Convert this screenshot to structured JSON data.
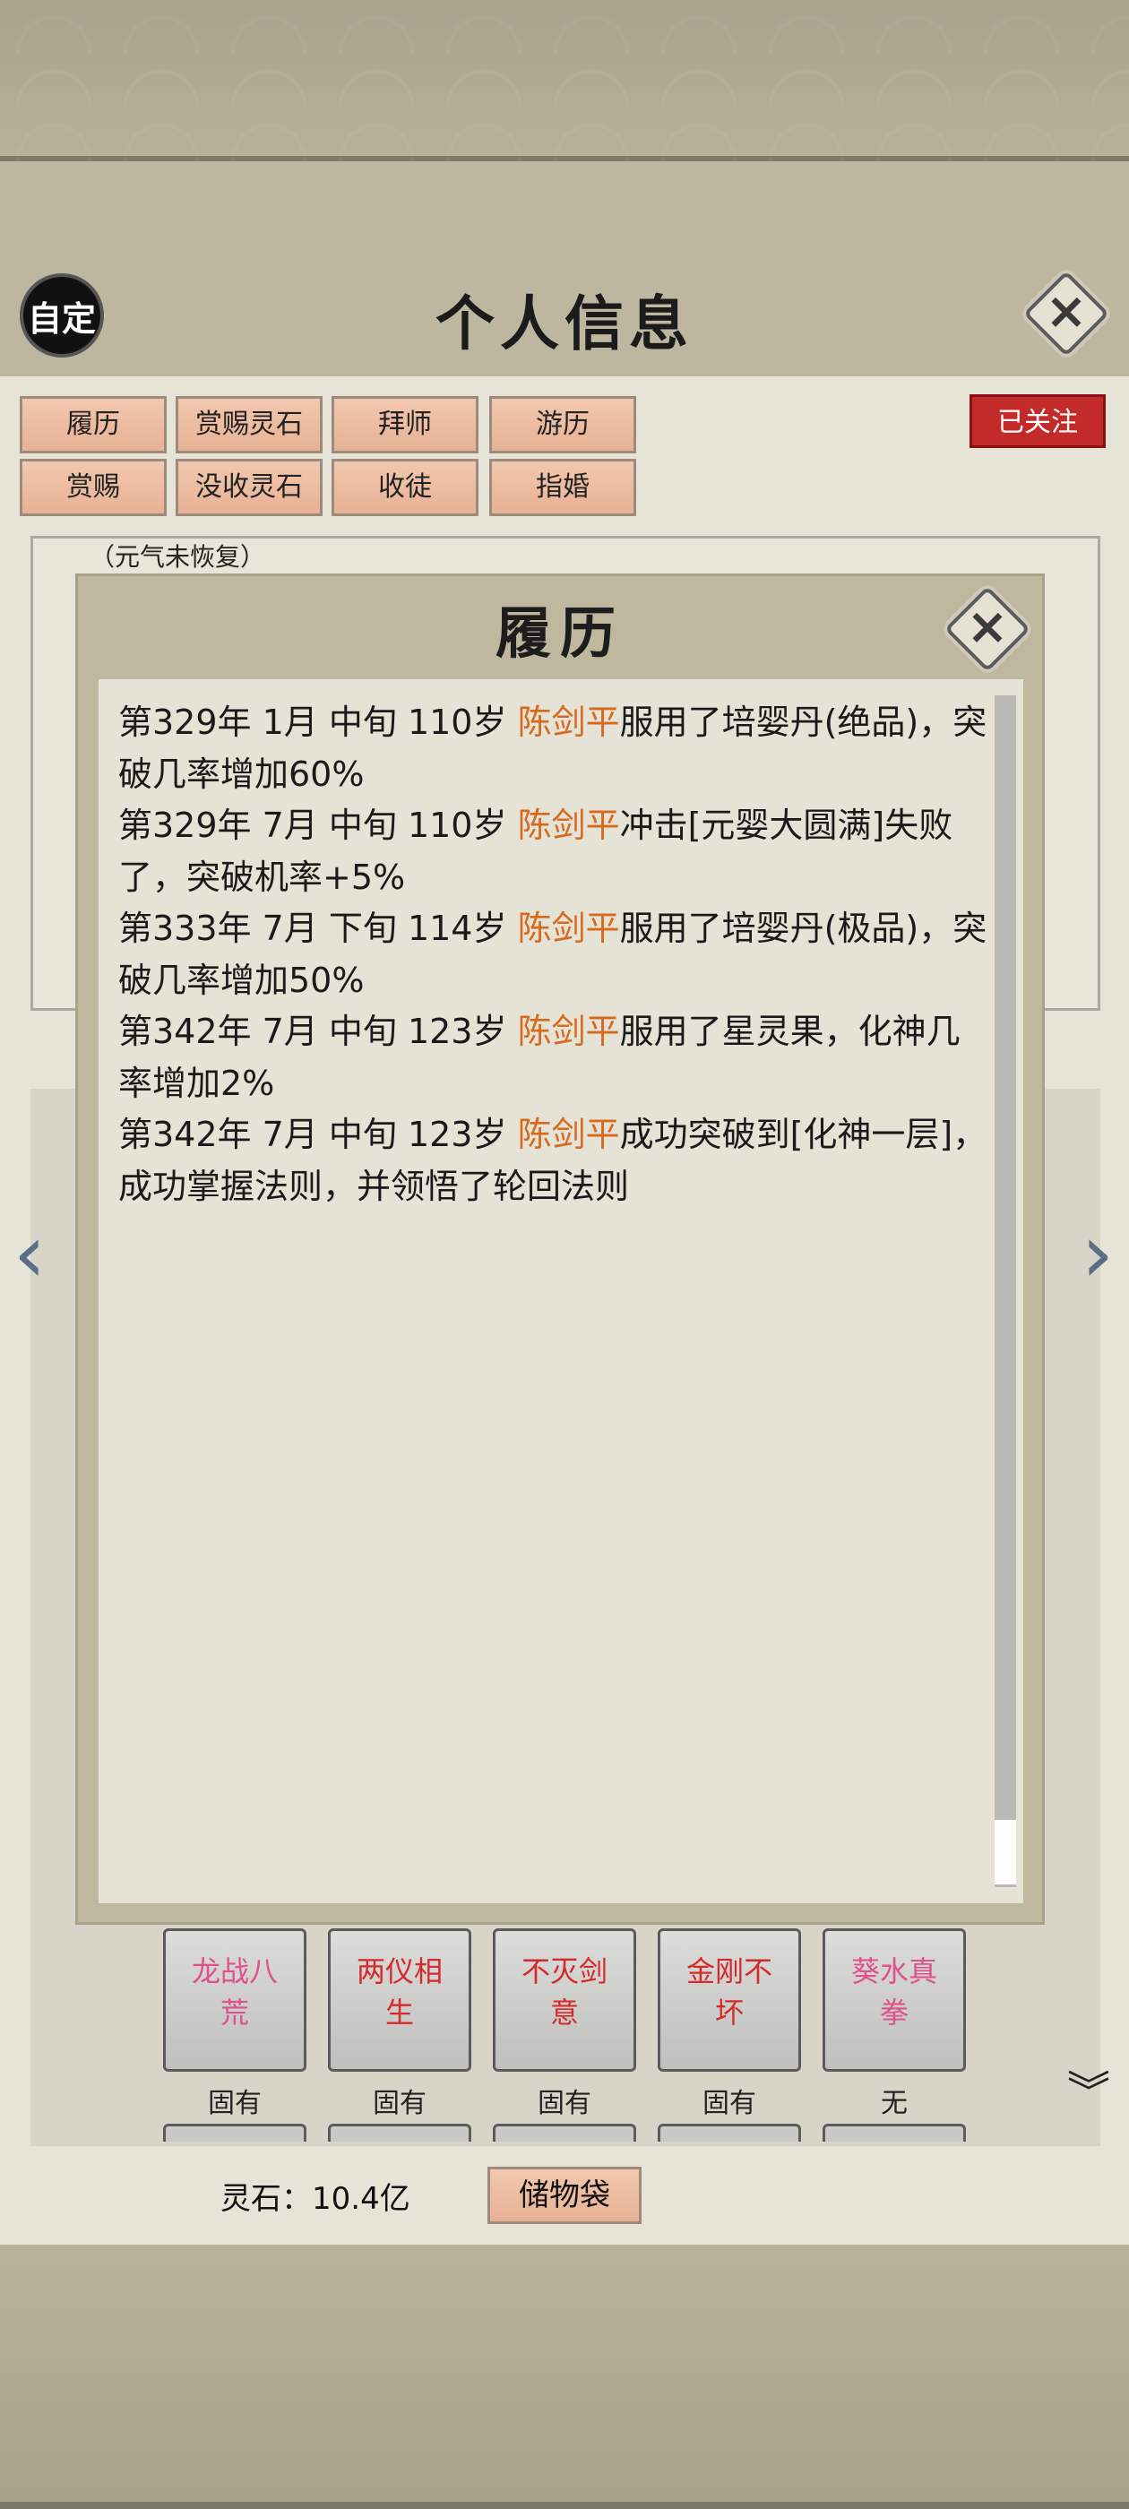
{
  "header": {
    "custom_button": "自定",
    "title": "个人信息"
  },
  "tabs": {
    "row1": [
      "履历",
      "赏赐灵石",
      "拜师",
      "游历"
    ],
    "row2": [
      "赏赐",
      "没收灵石",
      "收徒",
      "指婚"
    ]
  },
  "follow_badge": "已关注",
  "background_info": {
    "note": "（元气未恢复）"
  },
  "modal": {
    "title": "履历",
    "entries": [
      {
        "prefix": "第329年 1月 中旬 110岁 ",
        "name": "陈剑平",
        "suffix": "服用了培婴丹(绝品)，突破几率增加60%"
      },
      {
        "prefix": "第329年 7月 中旬 110岁 ",
        "name": "陈剑平",
        "suffix": "冲击[元婴大圆满]失败了，突破机率+5%"
      },
      {
        "prefix": "第333年 7月 下旬 114岁 ",
        "name": "陈剑平",
        "suffix": "服用了培婴丹(极品)，突破几率增加50%"
      },
      {
        "prefix": "第342年 7月  中旬  123岁  ",
        "name": "陈剑平",
        "suffix": "服用了星灵果，化神几率增加2%"
      },
      {
        "prefix": "第342年 7月  中旬   123岁   ",
        "name": "陈剑平",
        "suffix": "成功突破到[化神一层]，成功掌握法则，并领悟了轮回法则"
      }
    ],
    "scroll_fraction": 1.0
  },
  "skills": [
    {
      "line1": "龙战八",
      "line2": "荒",
      "caption": "固有",
      "color": "#e0508a"
    },
    {
      "line1": "两仪相",
      "line2": "生",
      "caption": "固有",
      "color": "#d42a2a"
    },
    {
      "line1": "不灭剑",
      "line2": "意",
      "caption": "固有",
      "color": "#d42a2a"
    },
    {
      "line1": "金刚不",
      "line2": "坏",
      "caption": "固有",
      "color": "#d42a2a"
    },
    {
      "line1": "葵水真",
      "line2": "拳",
      "caption": "无",
      "color": "#e0508a"
    }
  ],
  "footer": {
    "stones_label": "灵石：10.4亿",
    "bag_button": "储物袋"
  },
  "icons": {
    "close": "close-icon",
    "prev": "chevron-left-icon",
    "next": "chevron-right-icon",
    "down": "chevron-down-icon"
  }
}
